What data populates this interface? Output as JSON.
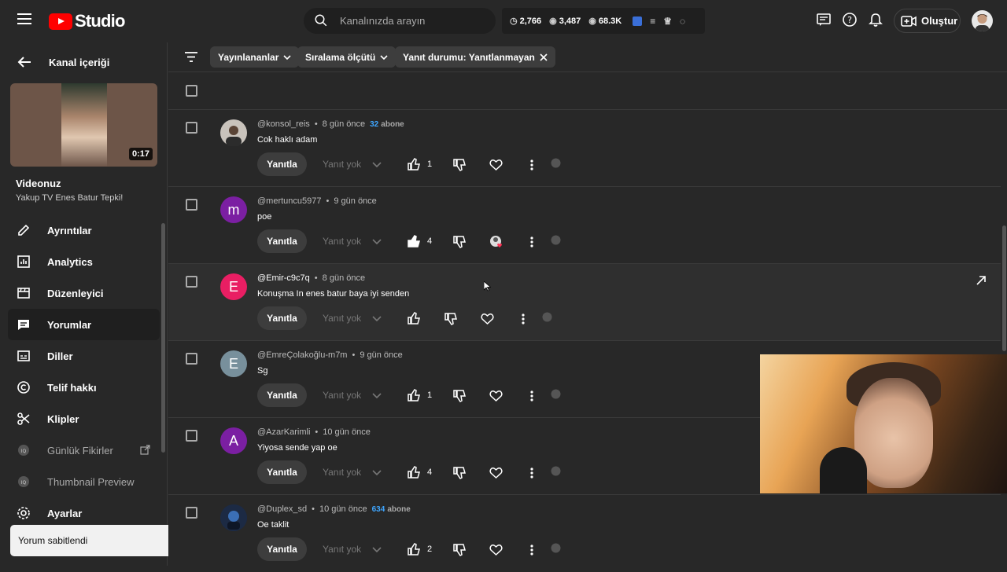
{
  "topbar": {
    "studio_label": "Studio",
    "search_placeholder": "Kanalınızda arayın",
    "stats": {
      "a": "2,766",
      "b": "3,487",
      "c": "68.3K"
    },
    "create_label": "Oluştur"
  },
  "sidebar": {
    "back_title": "Kanal içeriği",
    "duration": "0:17",
    "video_title": "Videonuz",
    "video_subtitle": "Yakup TV Enes Batur Tepki!",
    "items": [
      {
        "label": "Ayrıntılar",
        "icon": "pencil-icon"
      },
      {
        "label": "Analytics",
        "icon": "analytics-icon"
      },
      {
        "label": "Düzenleyici",
        "icon": "editor-icon"
      },
      {
        "label": "Yorumlar",
        "icon": "comments-icon"
      },
      {
        "label": "Diller",
        "icon": "subtitles-icon"
      },
      {
        "label": "Telif hakkı",
        "icon": "copyright-icon"
      },
      {
        "label": "Klipler",
        "icon": "scissors-icon"
      },
      {
        "label": "Günlük Fikirler",
        "icon": "vidiq-icon"
      },
      {
        "label": "Thumbnail Preview",
        "icon": "vidiq-icon"
      }
    ],
    "settings_label": "Ayarlar",
    "toast": "Yorum sabitlendi"
  },
  "filters": {
    "published": "Yayınlananlar",
    "sort": "Sıralama ölçütü",
    "reply_status": "Yanıt durumu: Yanıtlanmayan"
  },
  "comments": [
    {
      "author": "@konsol_reis",
      "time": "8 gün önce",
      "subs_num": "32",
      "subs_word": "abone",
      "text": "Cok haklı adam",
      "likes": "1",
      "reply": "Yanıtla",
      "noreply": "Yanıt yok"
    },
    {
      "author": "@mertuncu5977",
      "time": "9 gün önce",
      "subs_num": "",
      "subs_word": "",
      "text": "poe",
      "likes": "4",
      "reply": "Yanıtla",
      "noreply": "Yanıt yok"
    },
    {
      "author": "@Emir-c9c7q",
      "time": "8 gün önce",
      "subs_num": "",
      "subs_word": "",
      "text": "Konuşma In enes batur baya iyi senden",
      "likes": "",
      "reply": "Yanıtla",
      "noreply": "Yanıt yok"
    },
    {
      "author": "@EmreÇolakoğlu-m7m",
      "time": "9 gün önce",
      "subs_num": "",
      "subs_word": "",
      "text": "Sg",
      "likes": "1",
      "reply": "Yanıtla",
      "noreply": "Yanıt yok"
    },
    {
      "author": "@AzarKarimli",
      "time": "10 gün önce",
      "subs_num": "",
      "subs_word": "",
      "text": "Yiyosa sende yap oe",
      "likes": "4",
      "reply": "Yanıtla",
      "noreply": "Yanıt yok"
    },
    {
      "author": "@Duplex_sd",
      "time": "10 gün önce",
      "subs_num": "634",
      "subs_word": "abone",
      "text": "Oe taklit",
      "likes": "2",
      "reply": "Yanıtla",
      "noreply": "Yanıt yok"
    }
  ],
  "avatars": [
    "photo",
    "m",
    "E",
    "E",
    "A",
    "photo"
  ],
  "avatar_colors": [
    "#555555",
    "#7b1fa2",
    "#e91e63",
    "#78909c",
    "#7b1fa2",
    "#1c2a44"
  ],
  "accent": "#3ea6ff"
}
